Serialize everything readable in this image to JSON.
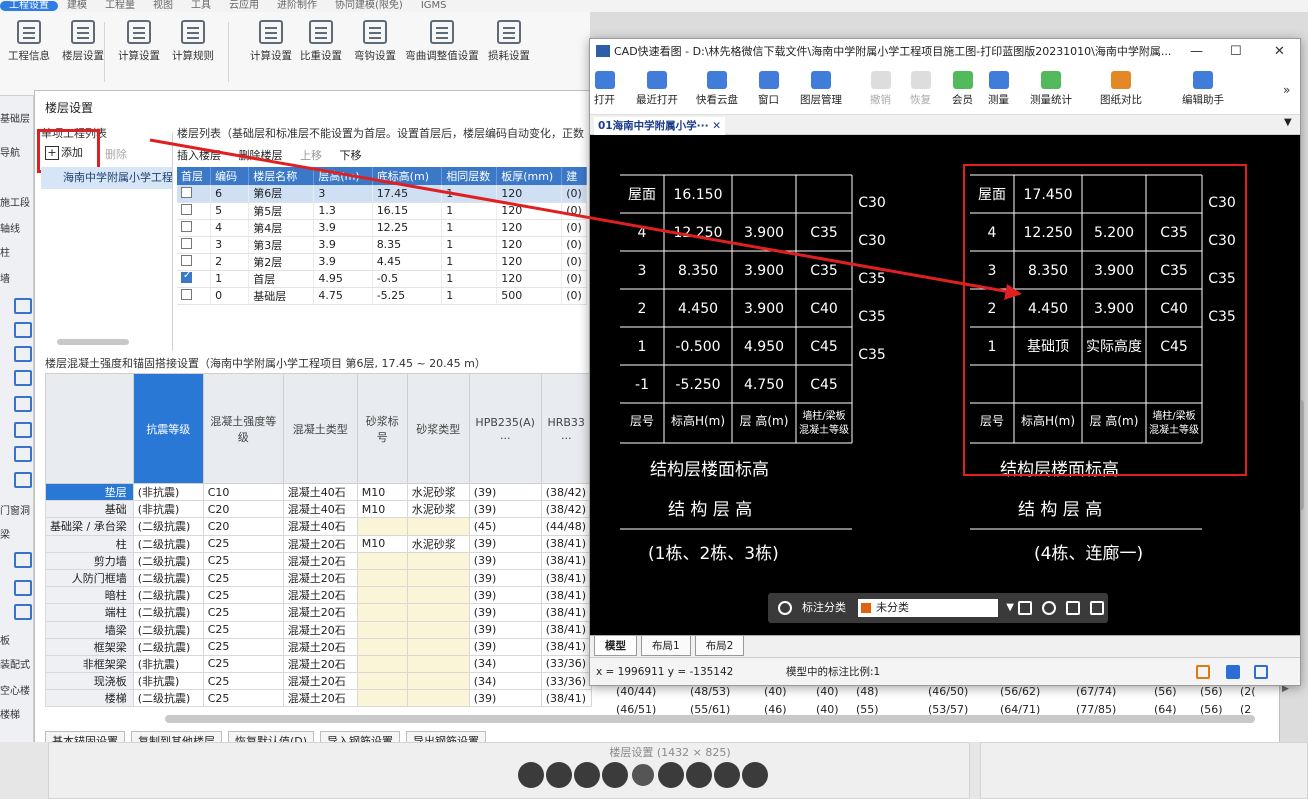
{
  "ribbon": {
    "tabs": [
      "工程设置",
      "建模",
      "工程量",
      "视图",
      "工具",
      "云应用",
      "进阶制作",
      "协同建模(限免)",
      "IGMS"
    ],
    "active_tab": "工程设置",
    "buttons": [
      {
        "label": "工程信息",
        "icon": "project-info-icon"
      },
      {
        "label": "楼层设置",
        "icon": "floor-settings-icon"
      },
      {
        "label": "计算设置",
        "icon": "calc-settings-icon"
      },
      {
        "label": "计算规则",
        "icon": "calc-rules-icon"
      },
      {
        "label": "计算设置",
        "icon": "calc-settings-icon"
      },
      {
        "label": "比重设置",
        "icon": "weight-settings-icon"
      },
      {
        "label": "弯钩设置",
        "icon": "hook-settings-icon"
      },
      {
        "label": "弯曲调整值设置",
        "icon": "bend-adjust-icon"
      },
      {
        "label": "损耗设置",
        "icon": "loss-settings-icon"
      }
    ]
  },
  "side": {
    "items": [
      "基础层",
      "导航",
      "施工段",
      "轴线",
      "柱",
      "墙",
      "门窗洞",
      "梁",
      "板",
      "装配式",
      "空心楼",
      "楼梯"
    ]
  },
  "dialog": {
    "title": "楼层设置",
    "project_list_title": "单项工程列表",
    "add_label": "添加",
    "delete_label": "删除",
    "project_item": "海南中学附属小学工程",
    "floor_caption": "楼层列表（基础层和标准层不能设置为首层。设置首层后，楼层编码自动变化，正数",
    "tools": {
      "insert": "插入楼层",
      "delete": "删除楼层",
      "up": "上移",
      "down": "下移"
    },
    "floor_headers": [
      "首层",
      "编码",
      "楼层名称",
      "层高(m)",
      "底标高(m)",
      "相同层数",
      "板厚(mm)",
      "建"
    ],
    "floors": [
      {
        "first": false,
        "code": "6",
        "name": "第6层",
        "height": "3",
        "bottom": "17.45",
        "same": "1",
        "slab": "120",
        "x": "(0)",
        "selected": true
      },
      {
        "first": false,
        "code": "5",
        "name": "第5层",
        "height": "1.3",
        "bottom": "16.15",
        "same": "1",
        "slab": "120",
        "x": "(0)",
        "selected": false
      },
      {
        "first": false,
        "code": "4",
        "name": "第4层",
        "height": "3.9",
        "bottom": "12.25",
        "same": "1",
        "slab": "120",
        "x": "(0)",
        "selected": false
      },
      {
        "first": false,
        "code": "3",
        "name": "第3层",
        "height": "3.9",
        "bottom": "8.35",
        "same": "1",
        "slab": "120",
        "x": "(0)",
        "selected": false
      },
      {
        "first": false,
        "code": "2",
        "name": "第2层",
        "height": "3.9",
        "bottom": "4.45",
        "same": "1",
        "slab": "120",
        "x": "(0)",
        "selected": false
      },
      {
        "first": true,
        "code": "1",
        "name": "首层",
        "height": "4.95",
        "bottom": "-0.5",
        "same": "1",
        "slab": "120",
        "x": "(0)",
        "selected": false
      },
      {
        "first": false,
        "code": "0",
        "name": "基础层",
        "height": "4.75",
        "bottom": "-5.25",
        "same": "1",
        "slab": "500",
        "x": "(0)",
        "selected": false
      }
    ],
    "concrete_caption": "楼层混凝土强度和锚固搭接设置（海南中学附属小学工程项目 第6层, 17.45 ~ 20.45 m）",
    "concrete_headers": [
      "",
      "抗震等级",
      "混凝土强度等级",
      "混凝土类型",
      "砂浆标号",
      "砂浆类型",
      "HPB235(A)\n...",
      "HRB33\n..."
    ],
    "concrete_rows": [
      {
        "name": "垫层",
        "seismic": "(非抗震)",
        "grade": "C10",
        "type": "混凝土40石",
        "mortar": "M10",
        "mtype": "水泥砂浆",
        "a": "(39)",
        "b": "(38/42)"
      },
      {
        "name": "基础",
        "seismic": "(非抗震)",
        "grade": "C20",
        "type": "混凝土40石",
        "mortar": "M10",
        "mtype": "水泥砂浆",
        "a": "(39)",
        "b": "(38/42)"
      },
      {
        "name": "基础梁 / 承台梁",
        "seismic": "(二级抗震)",
        "grade": "C20",
        "type": "混凝土40石",
        "mortar": "",
        "mtype": "",
        "a": "(45)",
        "b": "(44/48)"
      },
      {
        "name": "柱",
        "seismic": "(二级抗震)",
        "grade": "C25",
        "type": "混凝土20石",
        "mortar": "M10",
        "mtype": "水泥砂浆",
        "a": "(39)",
        "b": "(38/41)"
      },
      {
        "name": "剪力墙",
        "seismic": "(二级抗震)",
        "grade": "C25",
        "type": "混凝土20石",
        "mortar": "",
        "mtype": "",
        "a": "(39)",
        "b": "(38/41)"
      },
      {
        "name": "人防门框墙",
        "seismic": "(二级抗震)",
        "grade": "C25",
        "type": "混凝土20石",
        "mortar": "",
        "mtype": "",
        "a": "(39)",
        "b": "(38/41)"
      },
      {
        "name": "暗柱",
        "seismic": "(二级抗震)",
        "grade": "C25",
        "type": "混凝土20石",
        "mortar": "",
        "mtype": "",
        "a": "(39)",
        "b": "(38/41)"
      },
      {
        "name": "端柱",
        "seismic": "(二级抗震)",
        "grade": "C25",
        "type": "混凝土20石",
        "mortar": "",
        "mtype": "",
        "a": "(39)",
        "b": "(38/41)"
      },
      {
        "name": "墙梁",
        "seismic": "(二级抗震)",
        "grade": "C25",
        "type": "混凝土20石",
        "mortar": "",
        "mtype": "",
        "a": "(39)",
        "b": "(38/41)"
      },
      {
        "name": "框架梁",
        "seismic": "(二级抗震)",
        "grade": "C25",
        "type": "混凝土20石",
        "mortar": "",
        "mtype": "",
        "a": "(39)",
        "b": "(38/41)"
      },
      {
        "name": "非框架梁",
        "seismic": "(非抗震)",
        "grade": "C25",
        "type": "混凝土20石",
        "mortar": "",
        "mtype": "",
        "a": "(34)",
        "b": "(33/36)"
      },
      {
        "name": "现浇板",
        "seismic": "(非抗震)",
        "grade": "C25",
        "type": "混凝土20石",
        "mortar": "",
        "mtype": "",
        "a": "(34)",
        "b": "(33/36)"
      },
      {
        "name": "楼梯",
        "seismic": "(二级抗震)",
        "grade": "C25",
        "type": "混凝土20石",
        "mortar": "",
        "mtype": "",
        "a": "(39)",
        "b": "(38/41)"
      }
    ],
    "right_fragment_row": [
      "(40/44)",
      "(48/53)",
      "(40)",
      "(40)",
      "(48)",
      "(46/50)",
      "(56/62)",
      "(67/74)",
      "(56)",
      "(56)",
      "(2("
    ],
    "right_fragment_row2": [
      "(46/51)",
      "(55/61)",
      "(46)",
      "(40)",
      "(55)",
      "(53/57)",
      "(64/71)",
      "(77/85)",
      "(64)",
      "(56)",
      "(2"
    ],
    "bottom_buttons": [
      "基本锚固设置",
      "复制到其他楼层",
      "恢复默认值(D)",
      "导入钢筋设置",
      "导出钢筋设置"
    ],
    "right_edge_label": "设置"
  },
  "cad": {
    "title": "CAD快速看图 - D:\\林先格微信下载文件\\海南中学附属小学工程项目施工图-打印蓝图版20231010\\海南中学附属...",
    "toolbar": [
      {
        "label": "打开",
        "icon": "open-folder-icon",
        "color": "#2b6fd6"
      },
      {
        "label": "最近打开",
        "icon": "recent-clock-icon",
        "color": "#2b6fd6"
      },
      {
        "label": "快看云盘",
        "icon": "cloud-icon",
        "color": "#2b6fd6"
      },
      {
        "label": "窗口",
        "icon": "window-icon",
        "color": "#2b6fd6"
      },
      {
        "label": "图层管理",
        "icon": "layers-icon",
        "color": "#2b6fd6"
      },
      {
        "label": "撤销",
        "icon": "undo-icon",
        "color": "#bbbbbb"
      },
      {
        "label": "恢复",
        "icon": "redo-icon",
        "color": "#bbbbbb"
      },
      {
        "label": "会员",
        "icon": "vip-icon",
        "color": "#3fb24a"
      },
      {
        "label": "测量",
        "icon": "ruler-icon",
        "color": "#2b6fd6"
      },
      {
        "label": "测量统计",
        "icon": "measure-stat-icon",
        "color": "#3fb24a"
      },
      {
        "label": "图纸对比",
        "icon": "compare-icon",
        "color": "#e07a10"
      },
      {
        "label": "编辑助手",
        "icon": "edit-helper-icon",
        "color": "#2b6fd6"
      }
    ],
    "more": "»",
    "tab": "01海南中学附属小学···",
    "layouts": [
      "模型",
      "布局1",
      "布局2"
    ],
    "coord": "x = 1996911  y = -135142",
    "scale": "模型中的标注比例:1",
    "float_bar": {
      "label": "标注分类",
      "value": "未分类"
    },
    "left_table": {
      "rows": [
        [
          "屋面",
          "16.150",
          "",
          ""
        ],
        [
          "4",
          "12.250",
          "3.900",
          "C35"
        ],
        [
          "3",
          "8.350",
          "3.900",
          "C35"
        ],
        [
          "2",
          "4.450",
          "3.900",
          "C40"
        ],
        [
          "1",
          "-0.500",
          "4.950",
          "C45"
        ],
        [
          "-1",
          "-5.250",
          "4.750",
          "C45"
        ]
      ],
      "side_grades": [
        "C30",
        "C30",
        "C35",
        "C35",
        "C35"
      ],
      "footer": [
        "层号",
        "标高H(m)",
        "层 高(m)",
        "墙柱/梁板\n混凝土等级"
      ],
      "note1": "结构层楼面标高",
      "note2": "结 构 层 高",
      "note3": "(1栋、2栋、3栋)"
    },
    "right_table": {
      "rows": [
        [
          "屋面",
          "17.450",
          "",
          ""
        ],
        [
          "4",
          "12.250",
          "5.200",
          "C35"
        ],
        [
          "3",
          "8.350",
          "3.900",
          "C35"
        ],
        [
          "2",
          "4.450",
          "3.900",
          "C40"
        ],
        [
          "1",
          "基础顶",
          "实际高度",
          "C45"
        ],
        [
          "",
          "",
          "",
          ""
        ]
      ],
      "side_grades": [
        "C30",
        "C30",
        "C35",
        "C35"
      ],
      "footer": [
        "层号",
        "标高H(m)",
        "层 高(m)",
        "墙柱/梁板\n混凝土等级"
      ],
      "note1": "结构层楼面标高",
      "note2": "结 构 层 高",
      "note3": "(4栋、连廊一)"
    }
  },
  "caption": "楼层设置 (1432 × 825)",
  "colors": {
    "accent": "#2a78d6",
    "highlight": "#e02020",
    "cad_bg": "#000000"
  }
}
